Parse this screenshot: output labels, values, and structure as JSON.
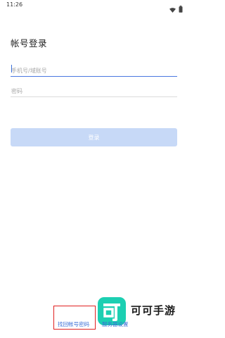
{
  "status_bar": {
    "time": "11:26",
    "icons": [
      "wifi-icon",
      "battery-icon"
    ]
  },
  "page": {
    "title": "帐号登录"
  },
  "form": {
    "phone_placeholder": "手机号/域账号",
    "password_placeholder": "密码",
    "login_label": "登录"
  },
  "footer": {
    "recover_label": "找回帐号密码",
    "server_label": "服务器设置"
  },
  "watermark": {
    "logo_glyph": "可",
    "text": "可可手游"
  },
  "colors": {
    "accent": "#3b6fd6",
    "button_disabled": "#c7d9f7",
    "highlight_border": "#e02020",
    "watermark_green": "#1ccfb2"
  }
}
